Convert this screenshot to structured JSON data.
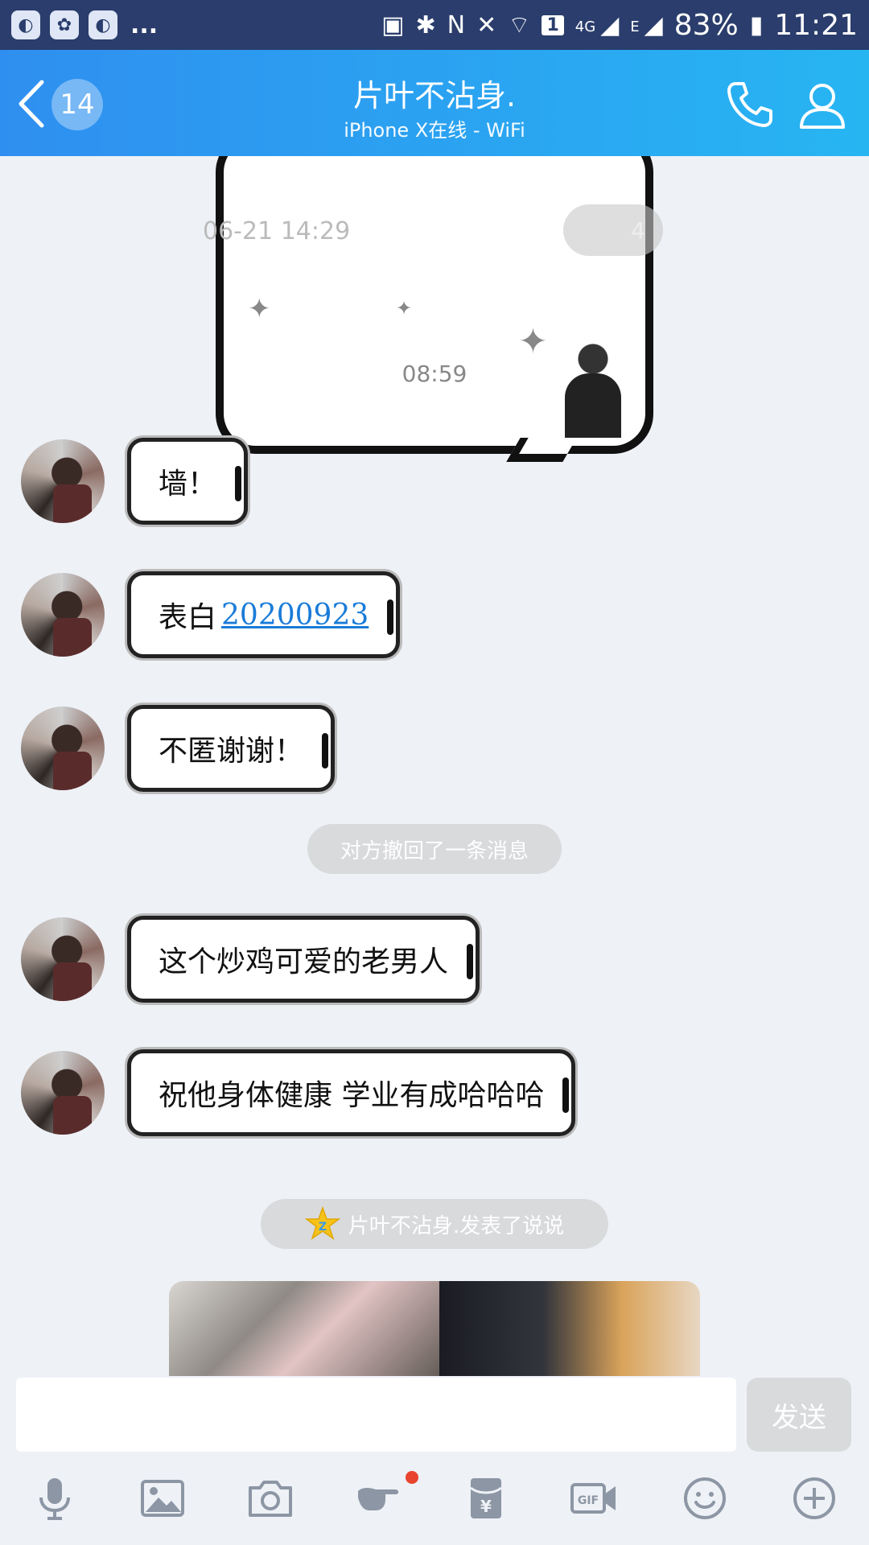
{
  "status_bar": {
    "overflow": "...",
    "network": "4G",
    "network2": "E",
    "sim": "1",
    "battery": "83%",
    "time": "11:21"
  },
  "header": {
    "unread_count": "14",
    "title": "片叶不沾身.",
    "subtitle": "iPhone X在线 - WiFi"
  },
  "chat": {
    "sticker_overlay_time": "06-21 14:29",
    "sticker_overlay_count": "4",
    "timestamp": "08:59",
    "messages": [
      {
        "text": "墙！"
      },
      {
        "text": "表白",
        "link": "20200923"
      },
      {
        "text": "不匿谢谢！"
      },
      {
        "text": "这个炒鸡可爱的老男人"
      },
      {
        "text": "祝他身体健康 学业有成哈哈哈"
      }
    ],
    "recall_notice": "对方撤回了一条消息",
    "qzone_notice": "片叶不沾身.发表了说说"
  },
  "input_bar": {
    "input_value": "",
    "send_label": "发送"
  },
  "toolbar": [
    "microphone-icon",
    "image-icon",
    "camera-icon",
    "poke-icon",
    "red-packet-icon",
    "gif-icon",
    "emoji-icon",
    "plus-icon"
  ],
  "colors": {
    "status_bar": "#2a3d6c",
    "header_start": "#2f8ff0",
    "header_end": "#27b5f2",
    "background": "#eef1f6",
    "link": "#1a7bd8",
    "notification_dot": "#e8442e"
  }
}
